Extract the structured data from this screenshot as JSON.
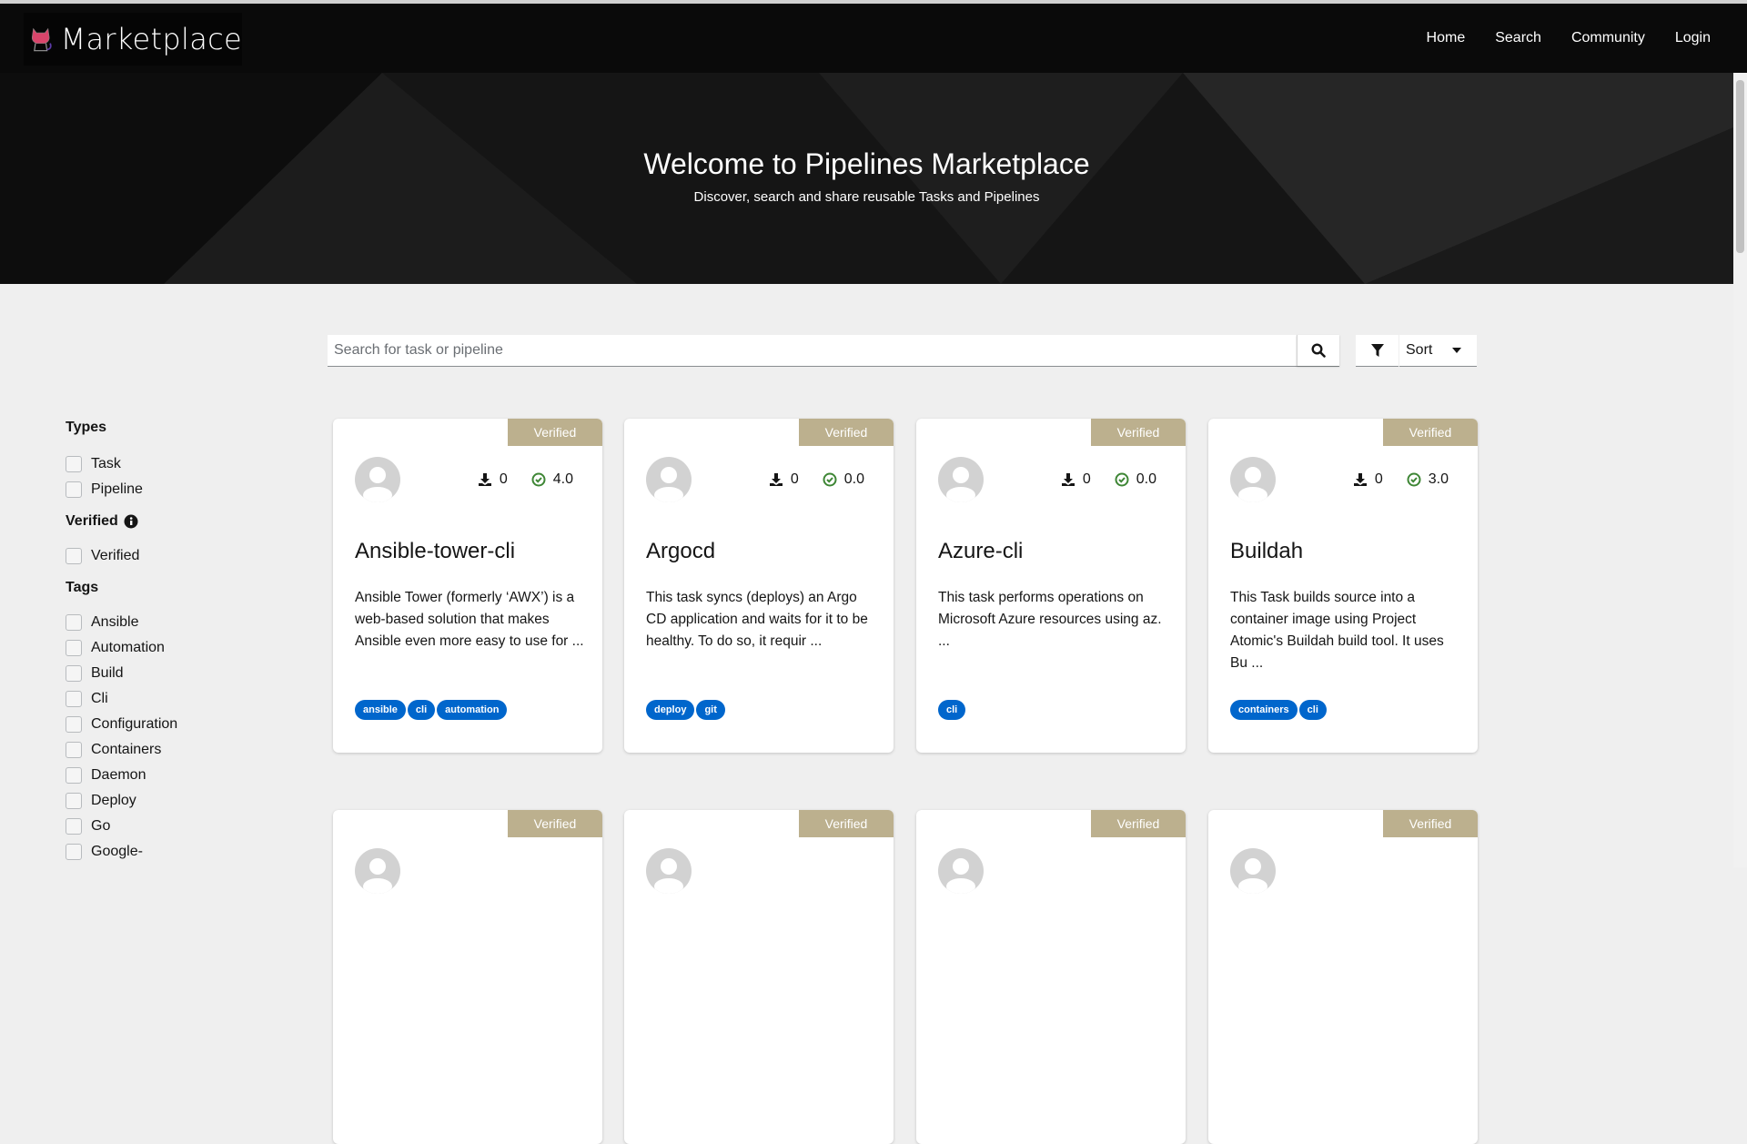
{
  "nav": {
    "logo_text": "Marketplace",
    "links": [
      "Home",
      "Search",
      "Community",
      "Login"
    ]
  },
  "hero": {
    "title": "Welcome to Pipelines Marketplace",
    "subtitle": "Discover, search and share reusable Tasks and Pipelines"
  },
  "search": {
    "placeholder": "Search for task or pipeline",
    "value": ""
  },
  "sort": {
    "label": "Sort"
  },
  "sidebar": {
    "types_heading": "Types",
    "types": [
      "Task",
      "Pipeline"
    ],
    "verified_heading": "Verified",
    "verified": [
      "Verified"
    ],
    "tags_heading": "Tags",
    "tags": [
      "Ansible",
      "Automation",
      "Build",
      "Cli",
      "Configuration",
      "Containers",
      "Daemon",
      "Deploy",
      "Go",
      "Google-"
    ]
  },
  "cards": [
    {
      "badge": "Verified",
      "downloads": "0",
      "rating": "4.0",
      "title": "Ansible-tower-cli",
      "description": "Ansible Tower (formerly ‘AWX’) is a web-based solution that makes Ansible even more easy to use for ...",
      "tags": [
        "ansible",
        "cli",
        "automation"
      ]
    },
    {
      "badge": "Verified",
      "downloads": "0",
      "rating": "0.0",
      "title": "Argocd",
      "description": "This task syncs (deploys) an Argo CD application and waits for it to be healthy. To do so, it requir ...",
      "tags": [
        "deploy",
        "git"
      ]
    },
    {
      "badge": "Verified",
      "downloads": "0",
      "rating": "0.0",
      "title": "Azure-cli",
      "description": "This task performs operations on Microsoft Azure resources using az. ...",
      "tags": [
        "cli"
      ]
    },
    {
      "badge": "Verified",
      "downloads": "0",
      "rating": "3.0",
      "title": "Buildah",
      "description": "This Task builds source into a container image using Project Atomic's Buildah build tool. It uses Bu ...",
      "tags": [
        "containers",
        "cli"
      ]
    },
    {
      "badge": "Verified"
    },
    {
      "badge": "Verified"
    },
    {
      "badge": "Verified"
    },
    {
      "badge": "Verified"
    }
  ],
  "colors": {
    "badge": "#bcb08e",
    "tag": "#0066cc",
    "rating": "#3e8635"
  }
}
